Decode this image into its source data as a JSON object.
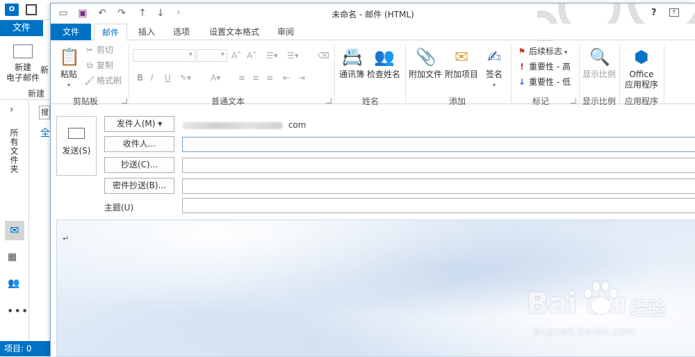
{
  "background_window": {
    "app_icon_label": "O",
    "file_tab": "文件",
    "new_email_label": "新建\n电子邮件",
    "new_items_label": "新",
    "group_new_label": "新建",
    "nav_chevron": "›",
    "all_folders_label": "所有文件夹",
    "search_placeholder": "搜",
    "all_label": "全",
    "status_bar": "项目: 0"
  },
  "compose_window": {
    "title": "未命名 - 邮件 (HTML)",
    "help": "?",
    "tabs": [
      {
        "label": "文件"
      },
      {
        "label": "邮件"
      },
      {
        "label": "插入"
      },
      {
        "label": "选项"
      },
      {
        "label": "设置文本格式"
      },
      {
        "label": "审阅"
      }
    ],
    "ribbon": {
      "clipboard": {
        "paste_label": "粘贴",
        "cut_label": "剪切",
        "copy_label": "复制",
        "format_painter_label": "格式刷",
        "group_label": "剪贴板"
      },
      "basic_text": {
        "group_label": "普通文本"
      },
      "names": {
        "address_book_label": "通讯簿",
        "check_names_label": "检查姓名",
        "group_label": "姓名"
      },
      "include": {
        "attach_file_label": "附加文件",
        "attach_item_label": "附加项目",
        "signature_label": "签名",
        "group_label": "添加"
      },
      "tags": {
        "follow_up_label": "后续标志",
        "high_importance_label": "重要性 - 高",
        "low_importance_label": "重要性 - 低",
        "group_label": "标记"
      },
      "zoom": {
        "zoom_label": "显示比例",
        "group_label": "显示比例"
      },
      "apps": {
        "office_apps_label": "Office\n应用程序",
        "group_label": "应用程序"
      }
    },
    "header": {
      "send_label": "发送(S)",
      "from_button": "发件人(M) ▾",
      "from_value_prefix": "",
      "from_value_suffix": "com",
      "to_button": "收件人...",
      "cc_button": "抄送(C)...",
      "bcc_button": "密件抄送(B)...",
      "subject_label": "主题(U)",
      "to_value": "",
      "cc_value": "",
      "bcc_value": "",
      "subject_value": ""
    },
    "body": {
      "caret": "↵"
    }
  },
  "watermark": {
    "logo_text": "Bai   du",
    "chinese_text": "经验",
    "url": "jingyan.baidu.com"
  },
  "colors": {
    "accent": "#0072c6",
    "body_tint": "#dbe7f5"
  }
}
